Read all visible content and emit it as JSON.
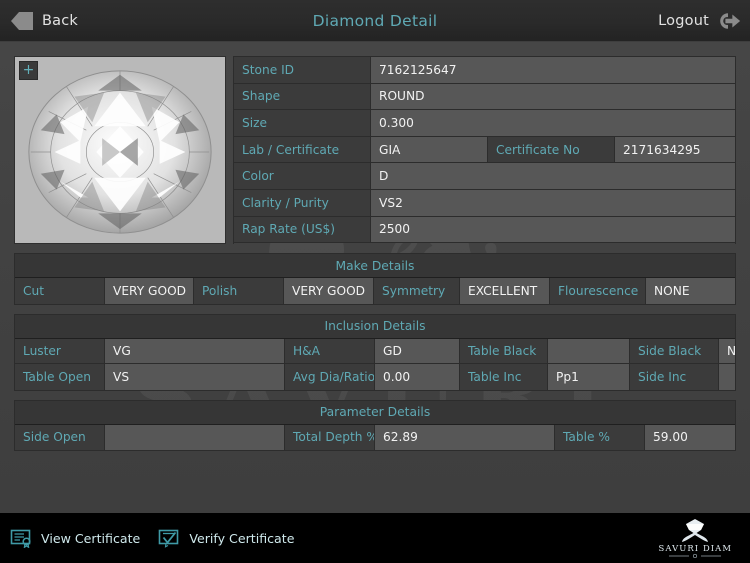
{
  "header": {
    "back_label": "Back",
    "title": "Diamond Detail",
    "logout_label": "Logout",
    "back_icon": "back-arrow-icon",
    "logout_icon": "logout-icon"
  },
  "image_panel": {
    "zoom_button_label": "+",
    "image_alt": "round-brilliant-diamond-photo"
  },
  "watermark": {
    "text": "SAVURI"
  },
  "spec": {
    "rows": [
      {
        "label": "Stone ID",
        "value": "7162125647"
      },
      {
        "label": "Shape",
        "value": "ROUND"
      },
      {
        "label": "Size",
        "value": "0.300"
      },
      {
        "label": "Lab / Certificate",
        "value": "GIA",
        "label2": "Certificate No",
        "value2": "2171634295"
      },
      {
        "label": "Color",
        "value": "D"
      },
      {
        "label": "Clarity / Purity",
        "value": "VS2"
      },
      {
        "label": "Rap Rate (US$)",
        "value": "2500"
      }
    ]
  },
  "make_details": {
    "title": "Make Details",
    "fields": [
      {
        "label": "Cut",
        "value": "VERY GOOD"
      },
      {
        "label": "Polish",
        "value": "VERY GOOD"
      },
      {
        "label": "Symmetry",
        "value": "EXCELLENT"
      },
      {
        "label": "Flourescence",
        "value": "NONE"
      }
    ]
  },
  "inclusion_details": {
    "title": "Inclusion Details",
    "row1": [
      {
        "label": "Luster",
        "value": "VG"
      },
      {
        "label": "H&A",
        "value": "GD"
      },
      {
        "label": "Table Black",
        "value": ""
      },
      {
        "label": "Side Black",
        "value": "N"
      }
    ],
    "row2": [
      {
        "label": "Table Open",
        "value": "VS"
      },
      {
        "label": "Avg Dia/Ratio",
        "value": "0.00"
      },
      {
        "label": "Table Inc",
        "value": "Pp1"
      },
      {
        "label": "Side Inc",
        "value": ""
      }
    ]
  },
  "parameter_details": {
    "title": "Parameter Details",
    "row1": [
      {
        "label": "Side Open",
        "value": ""
      },
      {
        "label": "Total Depth %",
        "value": "62.89"
      },
      {
        "label": "Table %",
        "value": "59.00"
      }
    ]
  },
  "footer": {
    "view_certificate_label": "View Certificate",
    "verify_certificate_label": "Verify Certificate",
    "brand_name": "SAVURI DIAM"
  },
  "colors": {
    "accent_teal": "#5fa9b4",
    "page_bg": "#434343",
    "label_cell": "#3b3b3b",
    "value_cell": "#575757",
    "header_bg": "#2a2a2a",
    "footer_bg": "#000000"
  }
}
